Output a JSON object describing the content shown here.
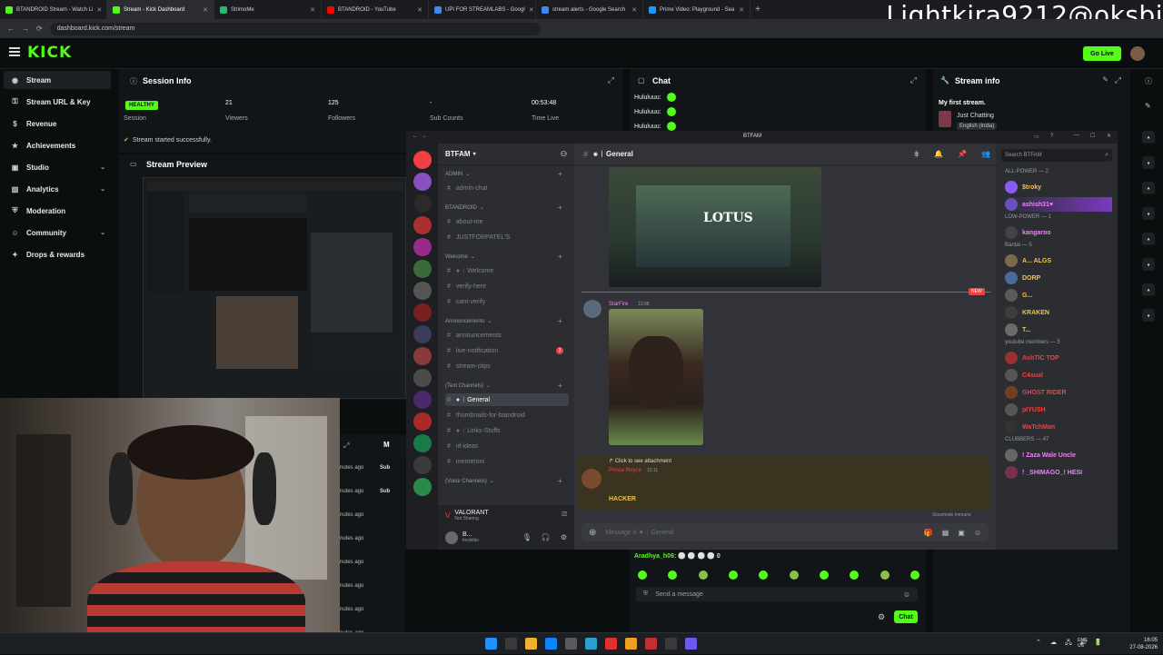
{
  "browser": {
    "tabs": [
      {
        "label": "BTANDROID Stream - Watch Li",
        "color": "#53fc18",
        "active": false
      },
      {
        "label": "Stream - Kick Dashboard",
        "color": "#53fc18",
        "active": true
      },
      {
        "label": "StrimoMe",
        "color": "#2bb673",
        "active": false
      },
      {
        "label": "BTANDROID - YouTube",
        "color": "#ff0000",
        "active": false
      },
      {
        "label": "UPI FOR STREAMLABS - Googl",
        "color": "#4285f4",
        "active": false
      },
      {
        "label": "stream alerts - Google Search",
        "color": "#4285f4",
        "active": false
      },
      {
        "label": "Prime Video: Playground - Sea",
        "color": "#1a98ff",
        "active": false
      }
    ],
    "url": "dashboard.kick.com/stream",
    "new_tab": "+"
  },
  "overlay_name": "Lightkira9212@oksbi",
  "kick": {
    "logo": "KICK",
    "go_live": "Go Live",
    "sidebar": [
      {
        "label": "Stream",
        "icon": "broadcast-icon",
        "glyph": "◉",
        "active": true,
        "chevron": false
      },
      {
        "label": "Stream URL & Key",
        "icon": "link-icon",
        "glyph": "⚿",
        "active": false,
        "chevron": false
      },
      {
        "label": "Revenue",
        "icon": "dollar-icon",
        "glyph": "$",
        "active": false,
        "chevron": false
      },
      {
        "label": "Achievements",
        "icon": "trophy-icon",
        "glyph": "★",
        "active": false,
        "chevron": false
      },
      {
        "label": "Studio",
        "icon": "studio-icon",
        "glyph": "▣",
        "active": false,
        "chevron": true
      },
      {
        "label": "Analytics",
        "icon": "chart-icon",
        "glyph": "▥",
        "active": false,
        "chevron": true
      },
      {
        "label": "Moderation",
        "icon": "shield-icon",
        "glyph": "⛨",
        "active": false,
        "chevron": false
      },
      {
        "label": "Community",
        "icon": "people-icon",
        "glyph": "☺",
        "active": false,
        "chevron": true
      },
      {
        "label": "Drops & rewards",
        "icon": "gift-icon",
        "glyph": "✦",
        "active": false,
        "chevron": false
      }
    ],
    "session": {
      "title": "Session Info",
      "status": "HEALTHY",
      "stats": [
        {
          "value": "",
          "label": "Session"
        },
        {
          "value": "21",
          "label": "Viewers"
        },
        {
          "value": "125",
          "label": "Followers"
        },
        {
          "value": "-",
          "label": "Sub Counts"
        },
        {
          "value": "00:53:48",
          "label": "Time Live"
        }
      ],
      "message": "Stream started successfully."
    },
    "preview": {
      "title": "Stream Preview"
    },
    "chat": {
      "title": "Chat",
      "messages": [
        "Hululuuu:",
        "Hululuuu:",
        "Hululuuu:"
      ],
      "last_user": "Aradhya_h06:",
      "last_count": "0",
      "placeholder": "Send a message",
      "send_label": "Chat"
    },
    "stream_info": {
      "title": "Stream info",
      "stream_title": "My first stream.",
      "category": "Just Chatting",
      "language": "English (India)"
    },
    "dock_label": "M",
    "side_times": [
      "nutes ago",
      "nutes ago",
      "nutes ago",
      "nutes ago",
      "nutes ago",
      "nutes ago",
      "nutes ago",
      "nutes ago"
    ],
    "side_subs": [
      "Sub",
      "Sub"
    ]
  },
  "discord": {
    "window_title": "BTFAM",
    "server_name": "BTFAM",
    "search_placeholder": "Search BTFAM",
    "channel_header": "✷ ᛁ General",
    "categories": [
      {
        "label": "ADMIN",
        "channels": [
          {
            "name": "admin-chat"
          }
        ]
      },
      {
        "label": "BTANDROID",
        "channels": [
          {
            "name": "about-me"
          },
          {
            "name": "JUSTFORPATEL'S"
          }
        ]
      },
      {
        "label": "Welcome",
        "channels": [
          {
            "name": "✷ ᛁ Welcome"
          },
          {
            "name": "verify-here"
          },
          {
            "name": "cant-verify"
          }
        ]
      },
      {
        "label": "Announcements",
        "channels": [
          {
            "name": "announcements"
          },
          {
            "name": "live-notification",
            "badge": "3"
          },
          {
            "name": "stream-clips"
          }
        ]
      },
      {
        "label": "(Text Channels)",
        "channels": [
          {
            "name": "✷ ᛁ General"
          },
          {
            "name": "thumbnails-for-btandroid"
          },
          {
            "name": "✷ ᛁ Links-Stuffs"
          },
          {
            "name": "irl-ideas"
          },
          {
            "name": "memeroni"
          }
        ]
      },
      {
        "label": "(Voice Channels)",
        "channels": []
      }
    ],
    "voice": {
      "game": "VALORANT",
      "status": "Not Sharing"
    },
    "user": {
      "name": "B...",
      "status": "Invisible"
    },
    "messages": {
      "image1_text": "LOTUS",
      "author": "StarFire",
      "time": "13:08",
      "attach_text": "Click to see attachment",
      "author2": "Prince Royce",
      "time2": "13:11",
      "sticker": "HACKER",
      "new_label": "NEW",
      "slowmode": "Slowmode Immune"
    },
    "composer_placeholder": "Message # ✷ ᛁ General",
    "members": [
      {
        "type": "cat",
        "label": "ALL-POWER — 2"
      },
      {
        "type": "mem",
        "name": "$troky",
        "color": "#f0c34e",
        "av": "#8a5cf6"
      },
      {
        "type": "mem",
        "name": "ashish31♥",
        "color": "#f47fff",
        "av": "#6b4fbb",
        "highlight": true
      },
      {
        "type": "cat",
        "label": "LOW-POWER — 1"
      },
      {
        "type": "mem",
        "name": "kangaroo",
        "color": "#f47fff",
        "av": "#444"
      },
      {
        "type": "cat",
        "label": "Bantai — 5"
      },
      {
        "type": "mem",
        "name": "A... ALGS",
        "color": "#f0c34e",
        "av": "#7a6a50"
      },
      {
        "type": "mem",
        "name": "DORP",
        "color": "#f0c34e",
        "av": "#4a6a9a"
      },
      {
        "type": "mem",
        "name": "G...",
        "color": "#f0c34e",
        "av": "#5a5a5a"
      },
      {
        "type": "mem",
        "name": "KRAKEN",
        "color": "#f0c34e",
        "av": "#3d3d3d"
      },
      {
        "type": "mem",
        "name": "T...",
        "color": "#f0c34e",
        "av": "#6a6a6a"
      },
      {
        "type": "cat",
        "label": "youtube members — 5"
      },
      {
        "type": "mem",
        "name": "AshTIC TOP",
        "color": "#f23f43",
        "av": "#9a3030"
      },
      {
        "type": "mem",
        "name": "C4sual",
        "color": "#f23f43",
        "av": "#555"
      },
      {
        "type": "mem",
        "name": "GHOST RIDER",
        "color": "#f23f43",
        "av": "#704020"
      },
      {
        "type": "mem",
        "name": "pIYUSH",
        "color": "#f23f43",
        "av": "#555"
      },
      {
        "type": "mem",
        "name": "WaTchMan",
        "color": "#f23f43",
        "av": "#333"
      },
      {
        "type": "cat",
        "label": "CLUBBERS — 47"
      },
      {
        "type": "mem",
        "name": "! Zaza Wale Uncle",
        "color": "#f47fff",
        "av": "#666"
      },
      {
        "type": "mem",
        "name": "! _SHIMAGO_! HESI",
        "color": "#f47fff",
        "av": "#7a3050"
      }
    ]
  },
  "taskbar": {
    "lang": "ENG\nUS",
    "time": "16:05",
    "date": "27-08-2026"
  },
  "colors": {
    "kick_green": "#53fc18",
    "discord_bg": "#313338",
    "discord_red": "#f23f43"
  }
}
